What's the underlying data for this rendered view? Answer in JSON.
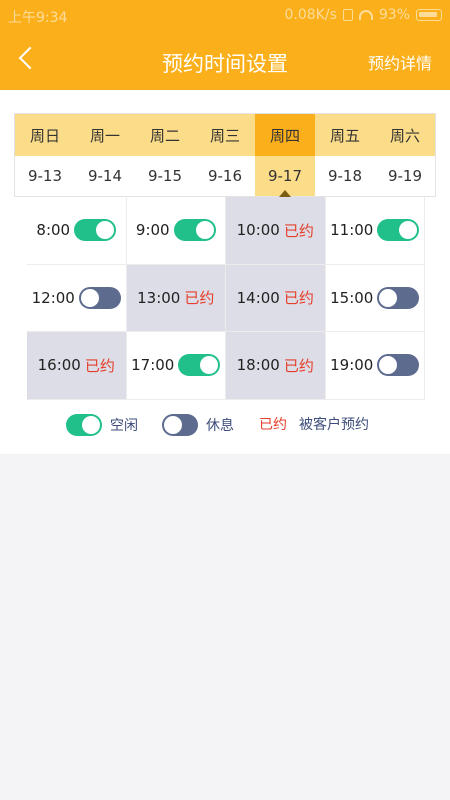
{
  "status": {
    "time": "上午9:34",
    "speed": "0.08K/s",
    "battery": "93%"
  },
  "header": {
    "title": "预约时间设置",
    "details_label": "预约详情"
  },
  "days": [
    {
      "weekday": "周日",
      "date": "9-13"
    },
    {
      "weekday": "周一",
      "date": "9-14"
    },
    {
      "weekday": "周二",
      "date": "9-15"
    },
    {
      "weekday": "周三",
      "date": "9-16"
    },
    {
      "weekday": "周四",
      "date": "9-17"
    },
    {
      "weekday": "周五",
      "date": "9-18"
    },
    {
      "weekday": "周六",
      "date": "9-19"
    }
  ],
  "selected_day_index": 4,
  "slots": [
    {
      "time": "8:00",
      "state": "free"
    },
    {
      "time": "9:00",
      "state": "free"
    },
    {
      "time": "10:00",
      "state": "booked"
    },
    {
      "time": "11:00",
      "state": "free"
    },
    {
      "time": "12:00",
      "state": "rest"
    },
    {
      "time": "13:00",
      "state": "booked"
    },
    {
      "time": "14:00",
      "state": "booked"
    },
    {
      "time": "15:00",
      "state": "rest"
    },
    {
      "time": "16:00",
      "state": "booked"
    },
    {
      "time": "17:00",
      "state": "free"
    },
    {
      "time": "18:00",
      "state": "booked"
    },
    {
      "time": "19:00",
      "state": "rest"
    }
  ],
  "booked_label": "已约",
  "legend": {
    "free": "空闲",
    "rest": "休息",
    "booked_word": "已约",
    "booked_desc": "被客户预约"
  },
  "colors": {
    "accent": "#fbb01b",
    "free": "#21c08b",
    "rest": "#5c6b8e",
    "booked": "#e53e2a"
  }
}
